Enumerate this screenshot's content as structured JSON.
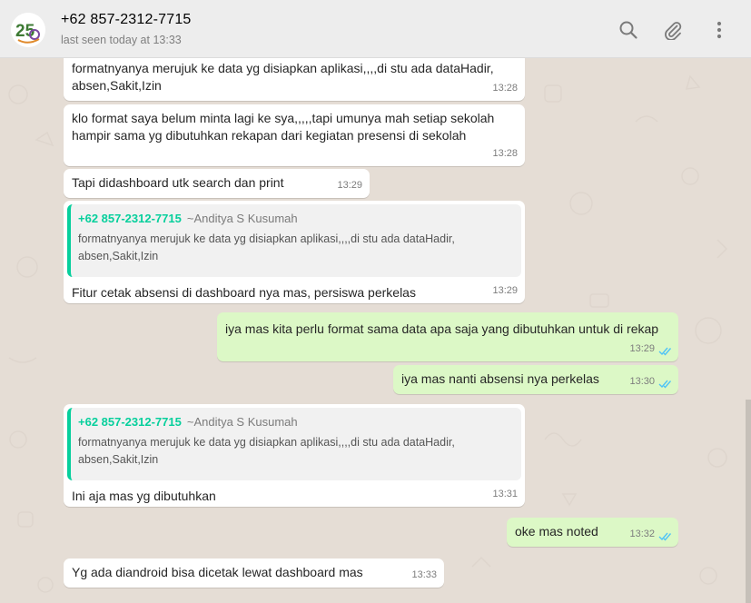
{
  "header": {
    "contact_name": "+62 857-2312-7715",
    "status": "last seen today at 13:33",
    "avatar_text": "25",
    "icons": [
      "search-icon",
      "attach-icon",
      "menu-icon"
    ]
  },
  "messages": [
    {
      "dir": "in",
      "text": "formatnyanya merujuk ke data yg disiapkan aplikasi,,,,di stu ada dataHadir,\nabsen,Sakit,Izin",
      "time": "13:28"
    },
    {
      "dir": "in",
      "text": "klo format saya belum minta lagi ke sya,,,,,tapi umunya mah setiap sekolah\nhampir sama yg dibutuhkan rekapan dari kegiatan presensi di sekolah",
      "time": "13:28"
    },
    {
      "dir": "in",
      "text": "Tapi didashboard utk search dan print",
      "time": "13:29"
    },
    {
      "dir": "in",
      "quote": {
        "author": "+62 857-2312-7715",
        "alias": "~Anditya S Kusumah",
        "text": "formatnyanya merujuk ke data yg disiapkan aplikasi,,,,di stu ada dataHadir,\nabsen,Sakit,Izin"
      },
      "text": "Fitur cetak absensi di dashboard nya mas, persiswa perkelas",
      "time": "13:29"
    },
    {
      "dir": "out",
      "text": "iya mas kita perlu format sama data apa saja yang dibutuhkan untuk di rekap",
      "time": "13:29"
    },
    {
      "dir": "out",
      "text": "iya mas nanti absensi nya perkelas",
      "time": "13:30"
    },
    {
      "dir": "in",
      "quote": {
        "author": "+62 857-2312-7715",
        "alias": "~Anditya S Kusumah",
        "text": "formatnyanya merujuk ke data yg disiapkan aplikasi,,,,di stu ada dataHadir,\nabsen,Sakit,Izin"
      },
      "text": "Ini aja mas yg dibutuhkan",
      "time": "13:31"
    },
    {
      "dir": "out",
      "text": "oke mas noted",
      "time": "13:32"
    },
    {
      "dir": "in",
      "text": "Yg ada diandroid bisa dicetak lewat dashboard mas",
      "time": "13:33"
    }
  ],
  "colors": {
    "chat_background": "#e5ddd5",
    "incoming_bubble": "#ffffff",
    "outgoing_bubble": "#dcf8c6",
    "quote_accent": "#06cf9c",
    "read_ticks": "#4fc3f7"
  }
}
